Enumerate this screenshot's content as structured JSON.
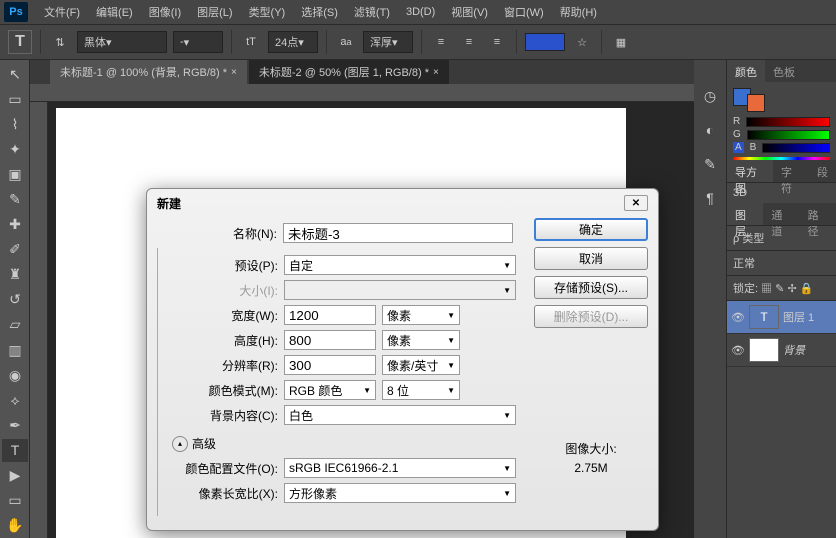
{
  "menubar": {
    "items": [
      "文件(F)",
      "编辑(E)",
      "图像(I)",
      "图层(L)",
      "类型(Y)",
      "选择(S)",
      "滤镜(T)",
      "3D(D)",
      "视图(V)",
      "窗口(W)",
      "帮助(H)"
    ]
  },
  "optionsbar": {
    "tool_letter": "T",
    "font_family": "黑体",
    "font_style": "-",
    "font_size": "24点",
    "antialias_icon": "a",
    "sharpness": "浑厚"
  },
  "tabs": [
    {
      "label": "未标题-1 @ 100% (背景, RGB/8) *",
      "active": false
    },
    {
      "label": "未标题-2 @ 50% (图层 1, RGB/8) *",
      "active": true
    }
  ],
  "dialog": {
    "title": "新建",
    "name_label": "名称(N):",
    "name_value": "未标题-3",
    "preset_label": "预设(P):",
    "preset_value": "自定",
    "size_label": "大小(I):",
    "width_label": "宽度(W):",
    "width_value": "1200",
    "width_unit": "像素",
    "height_label": "高度(H):",
    "height_value": "800",
    "height_unit": "像素",
    "res_label": "分辨率(R):",
    "res_value": "300",
    "res_unit": "像素/英寸",
    "mode_label": "颜色模式(M):",
    "mode_value": "RGB 颜色",
    "bit_value": "8 位",
    "bg_label": "背景内容(C):",
    "bg_value": "白色",
    "advanced": "高级",
    "profile_label": "颜色配置文件(O):",
    "profile_value": "sRGB IEC61966-2.1",
    "aspect_label": "像素长宽比(X):",
    "aspect_value": "方形像素",
    "ok": "确定",
    "cancel": "取消",
    "save_preset": "存储预设(S)...",
    "delete_preset": "删除预设(D)...",
    "img_size_label": "图像大小:",
    "img_size_value": "2.75M"
  },
  "right_panel": {
    "color_tab": "颜色",
    "swatches_tab": "色板",
    "r": "R",
    "g": "G",
    "b": "B",
    "nav_tab": "导方图",
    "char_tab": "字符",
    "para_tab": "段",
    "threed_label": "3D",
    "layers_tab": "图层",
    "channels_tab": "通道",
    "paths_tab": "路径",
    "kind": "ρ 类型",
    "blend": "正常",
    "lock_label": "锁定:",
    "layer1": "图层 1",
    "bg_layer": "背景"
  }
}
